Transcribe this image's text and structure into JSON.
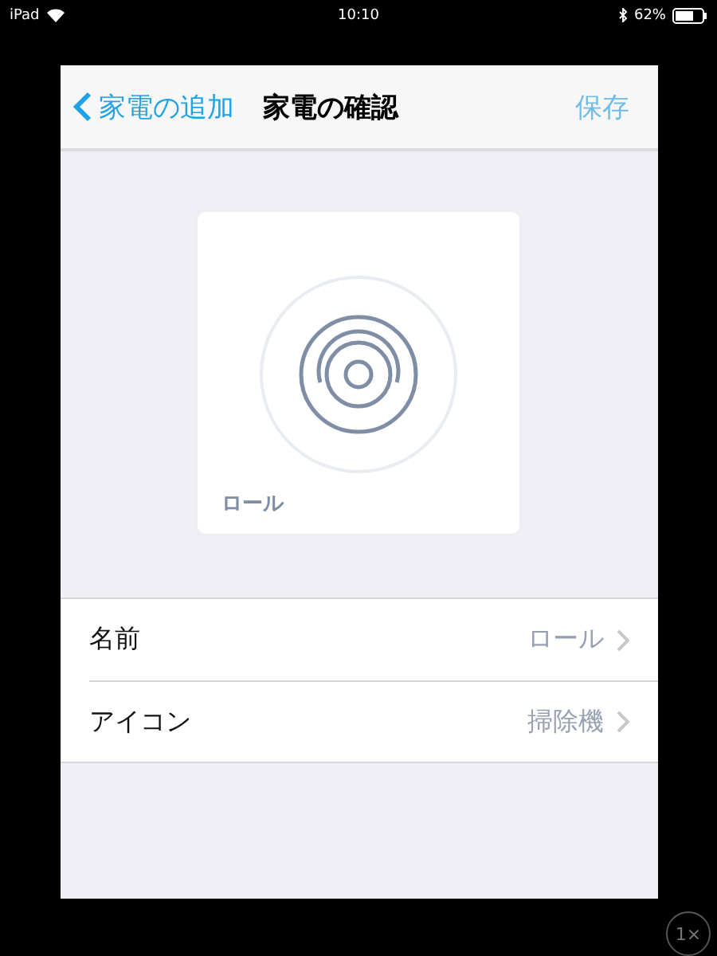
{
  "status_bar": {
    "device": "iPad",
    "time": "10:10",
    "battery": "62%"
  },
  "nav": {
    "back": "家電の追加",
    "title": "家電の確認",
    "save": {
      "label": "保存",
      "disabled": true
    }
  },
  "preview": {
    "label": "ロール"
  },
  "rows": [
    {
      "label": "名前",
      "value": "ロール"
    },
    {
      "label": "アイコン",
      "value": "掃除機"
    }
  ],
  "zoom_button": "1×"
}
